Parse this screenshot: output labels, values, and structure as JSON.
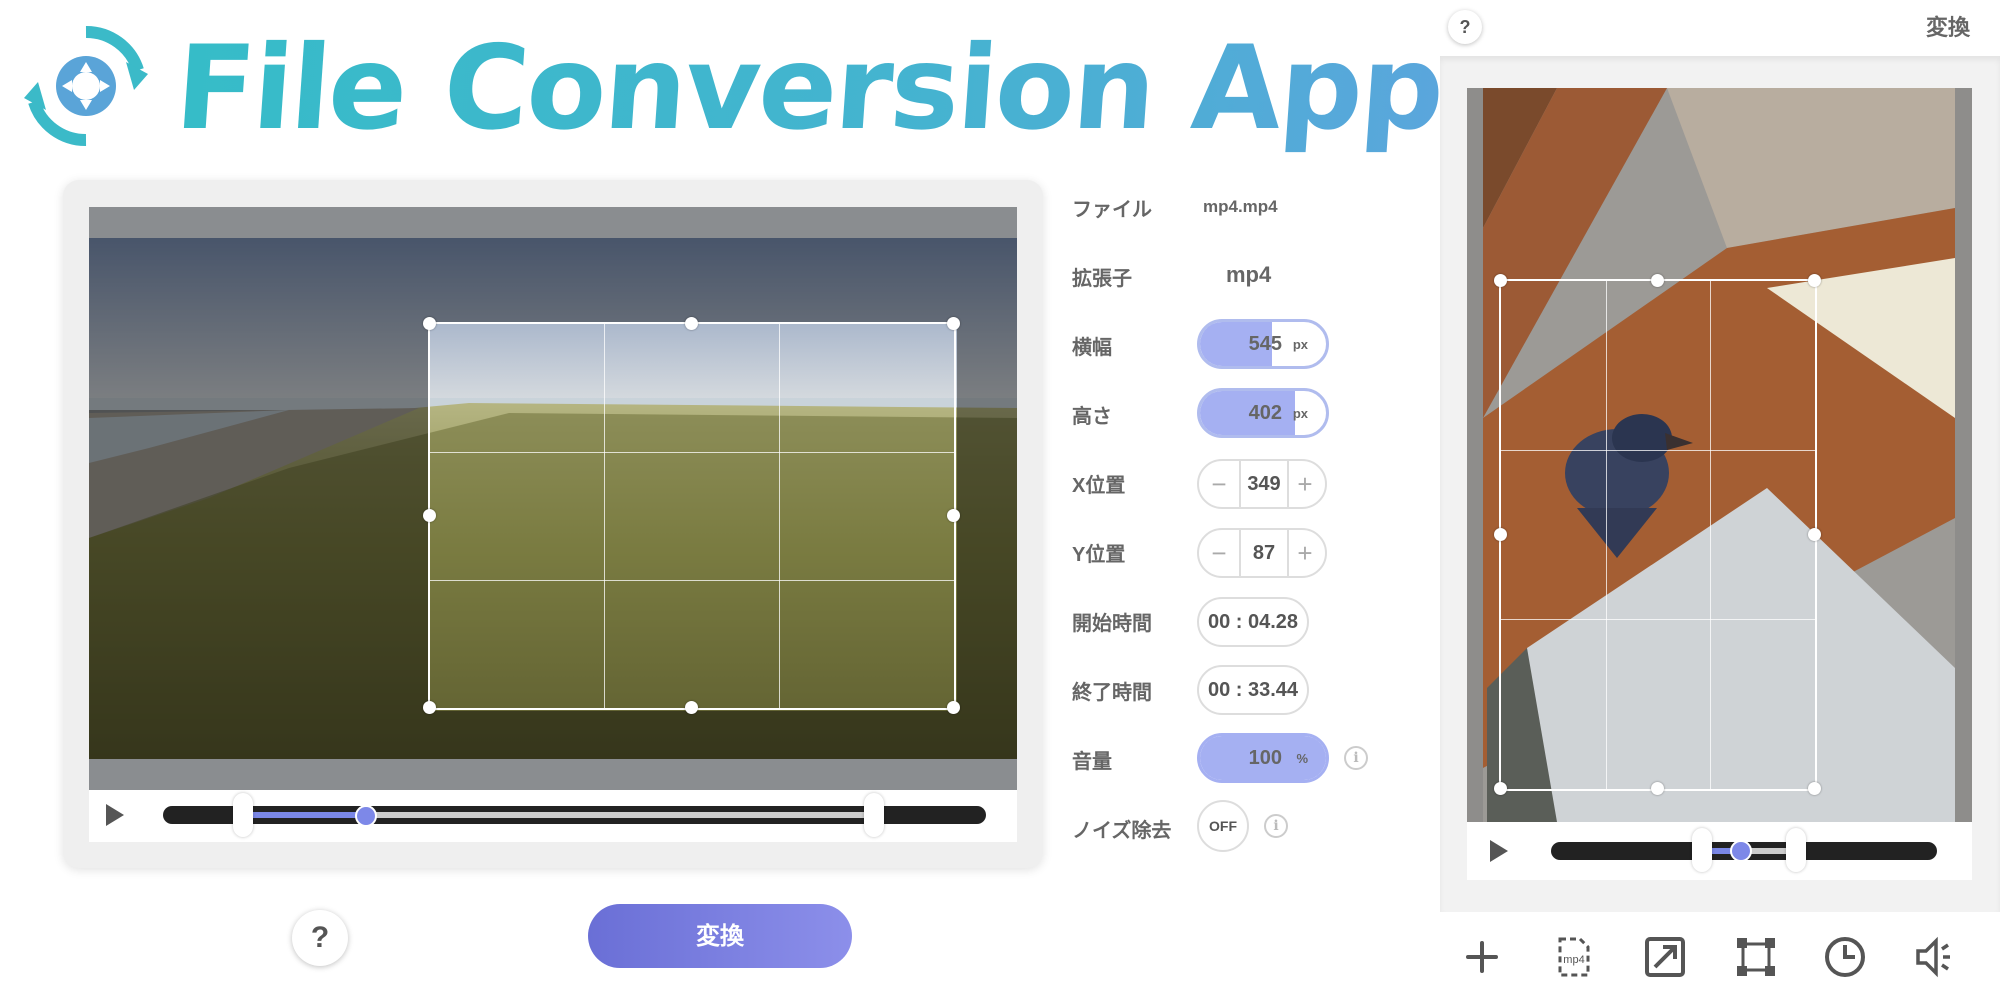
{
  "app": {
    "title": "File Conversion App"
  },
  "editor": {
    "convert_label": "変換",
    "help_label": "?"
  },
  "properties": {
    "file": {
      "label": "ファイル",
      "value": "mp4.mp4"
    },
    "extension": {
      "label": "拡張子",
      "value": "mp4"
    },
    "width": {
      "label": "横幅",
      "value": "545",
      "unit": "px",
      "fill_fraction": 0.57
    },
    "height": {
      "label": "高さ",
      "value": "402",
      "unit": "px",
      "fill_fraction": 0.75
    },
    "x_position": {
      "label": "X位置",
      "value": "349",
      "minus": "−",
      "plus": "+"
    },
    "y_position": {
      "label": "Y位置",
      "value": "87",
      "minus": "−",
      "plus": "+"
    },
    "start_time": {
      "label": "開始時間",
      "value": "00 : 04.28"
    },
    "end_time": {
      "label": "終了時間",
      "value": "00 : 33.44"
    },
    "volume": {
      "label": "音量",
      "value": "100",
      "unit": "%",
      "fill_fraction": 1.0
    },
    "noise_reduction": {
      "label": "ノイズ除去",
      "value": "OFF"
    },
    "info_glyph": "i"
  },
  "mobile": {
    "help_label": "?",
    "title": "変換",
    "toolbar": [
      {
        "name": "add-icon"
      },
      {
        "name": "format-mp4-icon",
        "text": "mp4"
      },
      {
        "name": "resize-icon"
      },
      {
        "name": "crop-icon"
      },
      {
        "name": "clock-icon"
      },
      {
        "name": "volume-icon"
      }
    ]
  },
  "colors": {
    "accent": "#7d88e8",
    "logo_teal": "#3cb6c8",
    "convert_button": "#7a7fe0",
    "pill_fill": "#a5b0f2"
  }
}
